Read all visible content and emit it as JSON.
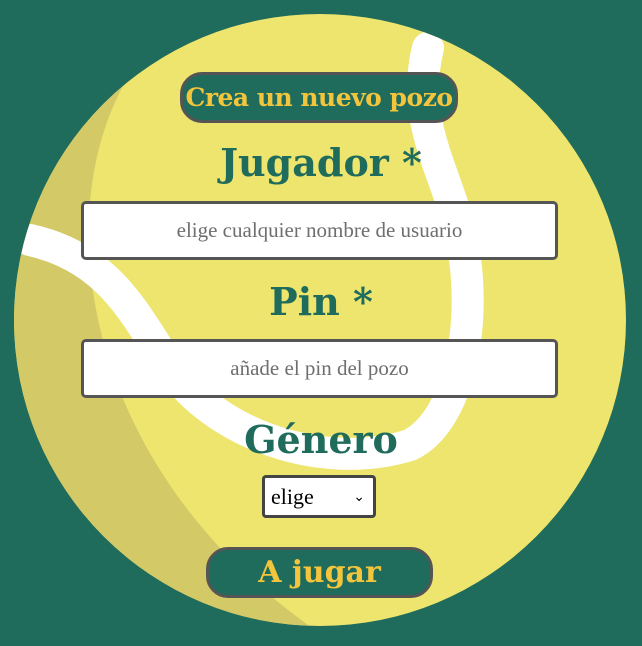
{
  "header": {
    "title": "Crea un nuevo pozo"
  },
  "form": {
    "player_label": "Jugador *",
    "player_placeholder": "elige cualquier nombre de usuario",
    "pin_label": "Pin *",
    "pin_placeholder": "añade el pin del pozo",
    "gender_label": "Género",
    "gender_selected": "elige",
    "submit_label": "A jugar"
  },
  "icons": {
    "background": "tennis-ball-icon",
    "select_arrow": "chevron-down-icon"
  },
  "colors": {
    "background": "#1f6b5c",
    "ball": "#eee56e",
    "ball_shadow": "#d3c967",
    "seam": "#ffffff",
    "accent_text": "#f2c53d"
  }
}
